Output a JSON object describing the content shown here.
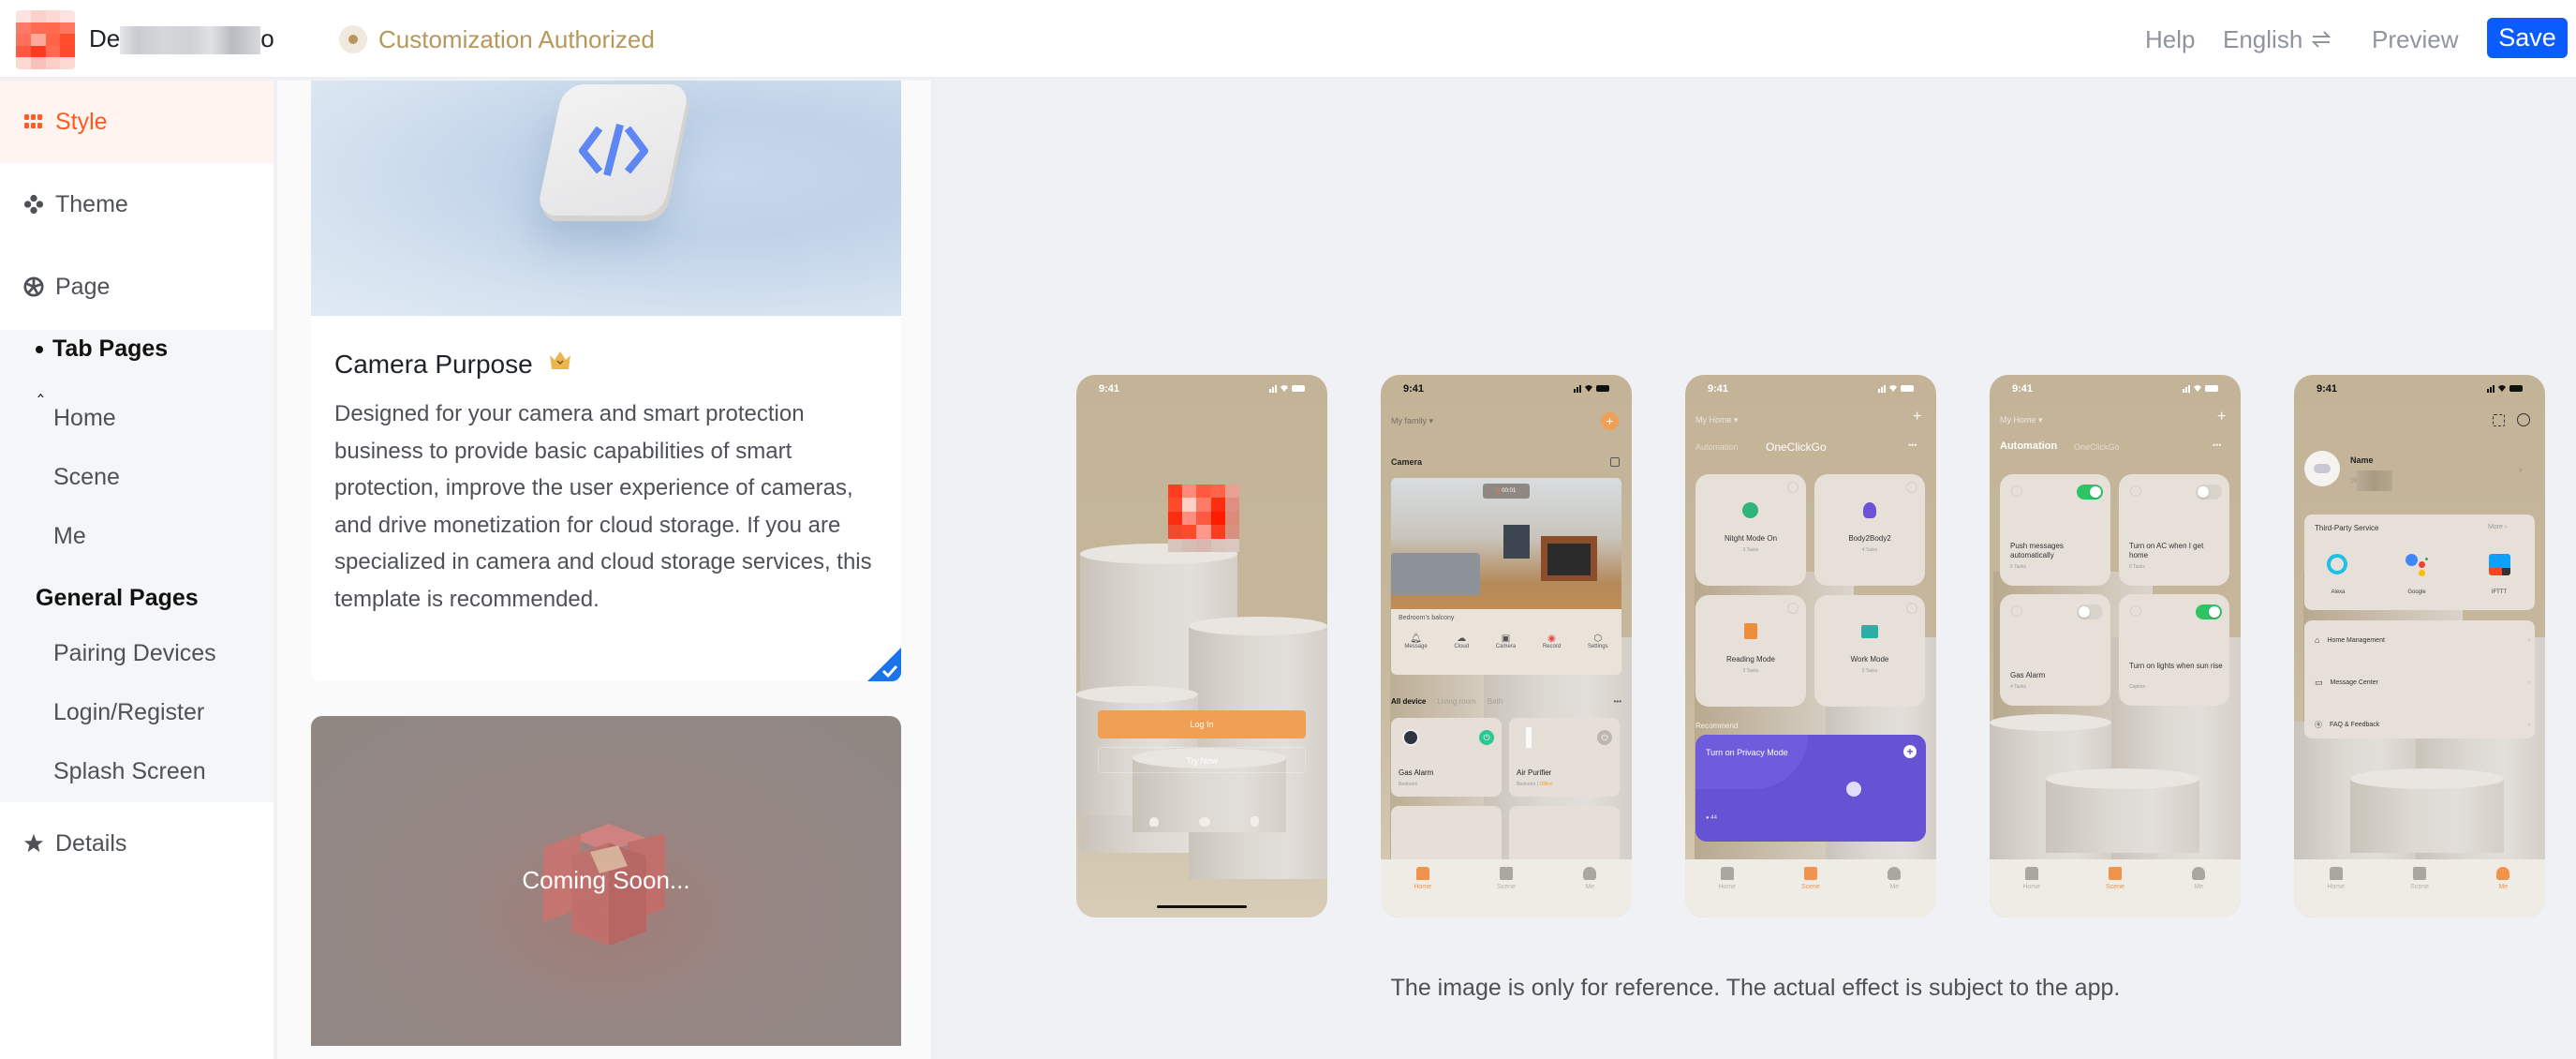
{
  "header": {
    "app_title_visible": "De",
    "app_title_end": "o",
    "badge_label": "Customization Authorized",
    "help_label": "Help",
    "language_label": "English",
    "language_icon": "swap-arrows-icon",
    "preview_label": "Preview",
    "save_label": "Save"
  },
  "colors": {
    "accent": "#ff5a1f",
    "primary_button": "#0b5cff",
    "badge_text": "#b8975a",
    "sidebar_active_bg": "#fff4f0",
    "phone_accent": "#f0934c"
  },
  "sidebar": {
    "items": [
      {
        "label": "Style",
        "icon": "grid-icon",
        "active": true
      },
      {
        "label": "Theme",
        "icon": "palette-icon",
        "active": false
      },
      {
        "label": "Page",
        "icon": "aperture-icon",
        "active": false
      }
    ],
    "tab_pages_heading": "Tab Pages",
    "collapse_icon": "chevron-up-icon",
    "tab_pages": [
      "Home",
      "Scene",
      "Me"
    ],
    "general_pages_heading": "General Pages",
    "general_pages": [
      "Pairing Devices",
      "Login/Register",
      "Splash Screen"
    ],
    "details": {
      "label": "Details",
      "icon": "star-icon"
    }
  },
  "templates": {
    "card1": {
      "title": "Camera Purpose",
      "badge_icon": "crown-icon",
      "description": "Designed for your camera and smart protection business to provide basic capabilities of smart protection, improve the user experience of cameras, and drive monetization for cloud storage. If you are specialized in camera and cloud storage services, this template is recommended.",
      "selected": true
    },
    "card2": {
      "overlay_text": "Coming Soon..."
    }
  },
  "phones": {
    "time": "9:41",
    "login": {
      "login_button": "Log In",
      "try_now": "Try Now"
    },
    "home": {
      "family_selector": "My family",
      "section_title": "Camera",
      "rec_time": "00:01",
      "camera_name": "Bedroom’s balcony",
      "camera_actions": [
        "Message",
        "Cloud",
        "Camera",
        "Record",
        "Settings"
      ],
      "room_tabs": [
        "All device",
        "Living room",
        "Bath"
      ],
      "devices": [
        {
          "name": "Gas Alarm",
          "room": "Bedroom",
          "status": "",
          "on": true
        },
        {
          "name": "Air Purifier",
          "room": "Bedroom",
          "status": "Offline",
          "on": false
        }
      ],
      "tabbar": [
        "Home",
        "Scene",
        "Me"
      ]
    },
    "scene": {
      "home_selector": "My Home",
      "tabs": [
        "Automation",
        "OneClickGo"
      ],
      "scenes": [
        {
          "name": "Nitght Mode On",
          "tasks": "3 Tasks"
        },
        {
          "name": "Body2Body2",
          "tasks": "4 Tasks"
        },
        {
          "name": "Reading Mode",
          "tasks": "2 Tasks"
        },
        {
          "name": "Work Mode",
          "tasks": "3 Tasks"
        }
      ],
      "recommend_label": "Recommend",
      "recommend_title": "Turn on Privacy Mode",
      "recommend_count": "44",
      "tabbar": [
        "Home",
        "Scene",
        "Me"
      ]
    },
    "automation": {
      "home_selector": "My Home",
      "tabs": [
        "Automation",
        "OneClickGo"
      ],
      "automations": [
        {
          "name": "Push messages automatically",
          "tasks": "6 Tasks",
          "on": true
        },
        {
          "name": "Turn on AC when I get home",
          "tasks": "6 Tasks",
          "on": false
        },
        {
          "name": "Gas Alarm",
          "tasks": "4 Tasks",
          "on": false
        },
        {
          "name": "Turn on lights when sun rise",
          "tasks": "Caption",
          "on": true
        }
      ],
      "tabbar": [
        "Home",
        "Scene",
        "Me"
      ]
    },
    "me": {
      "user_name": "Name",
      "user_id_prefix": "19",
      "third_party_title": "Third-Party Service",
      "more_label": "More",
      "services": [
        "Alexa",
        "Google",
        "IFTTT"
      ],
      "menu": [
        "Home Management",
        "Message Center",
        "FAQ & Feedback"
      ],
      "tabbar": [
        "Home",
        "Scene",
        "Me"
      ]
    }
  },
  "preview_caption": "The image is only for reference. The actual effect is subject to the app."
}
